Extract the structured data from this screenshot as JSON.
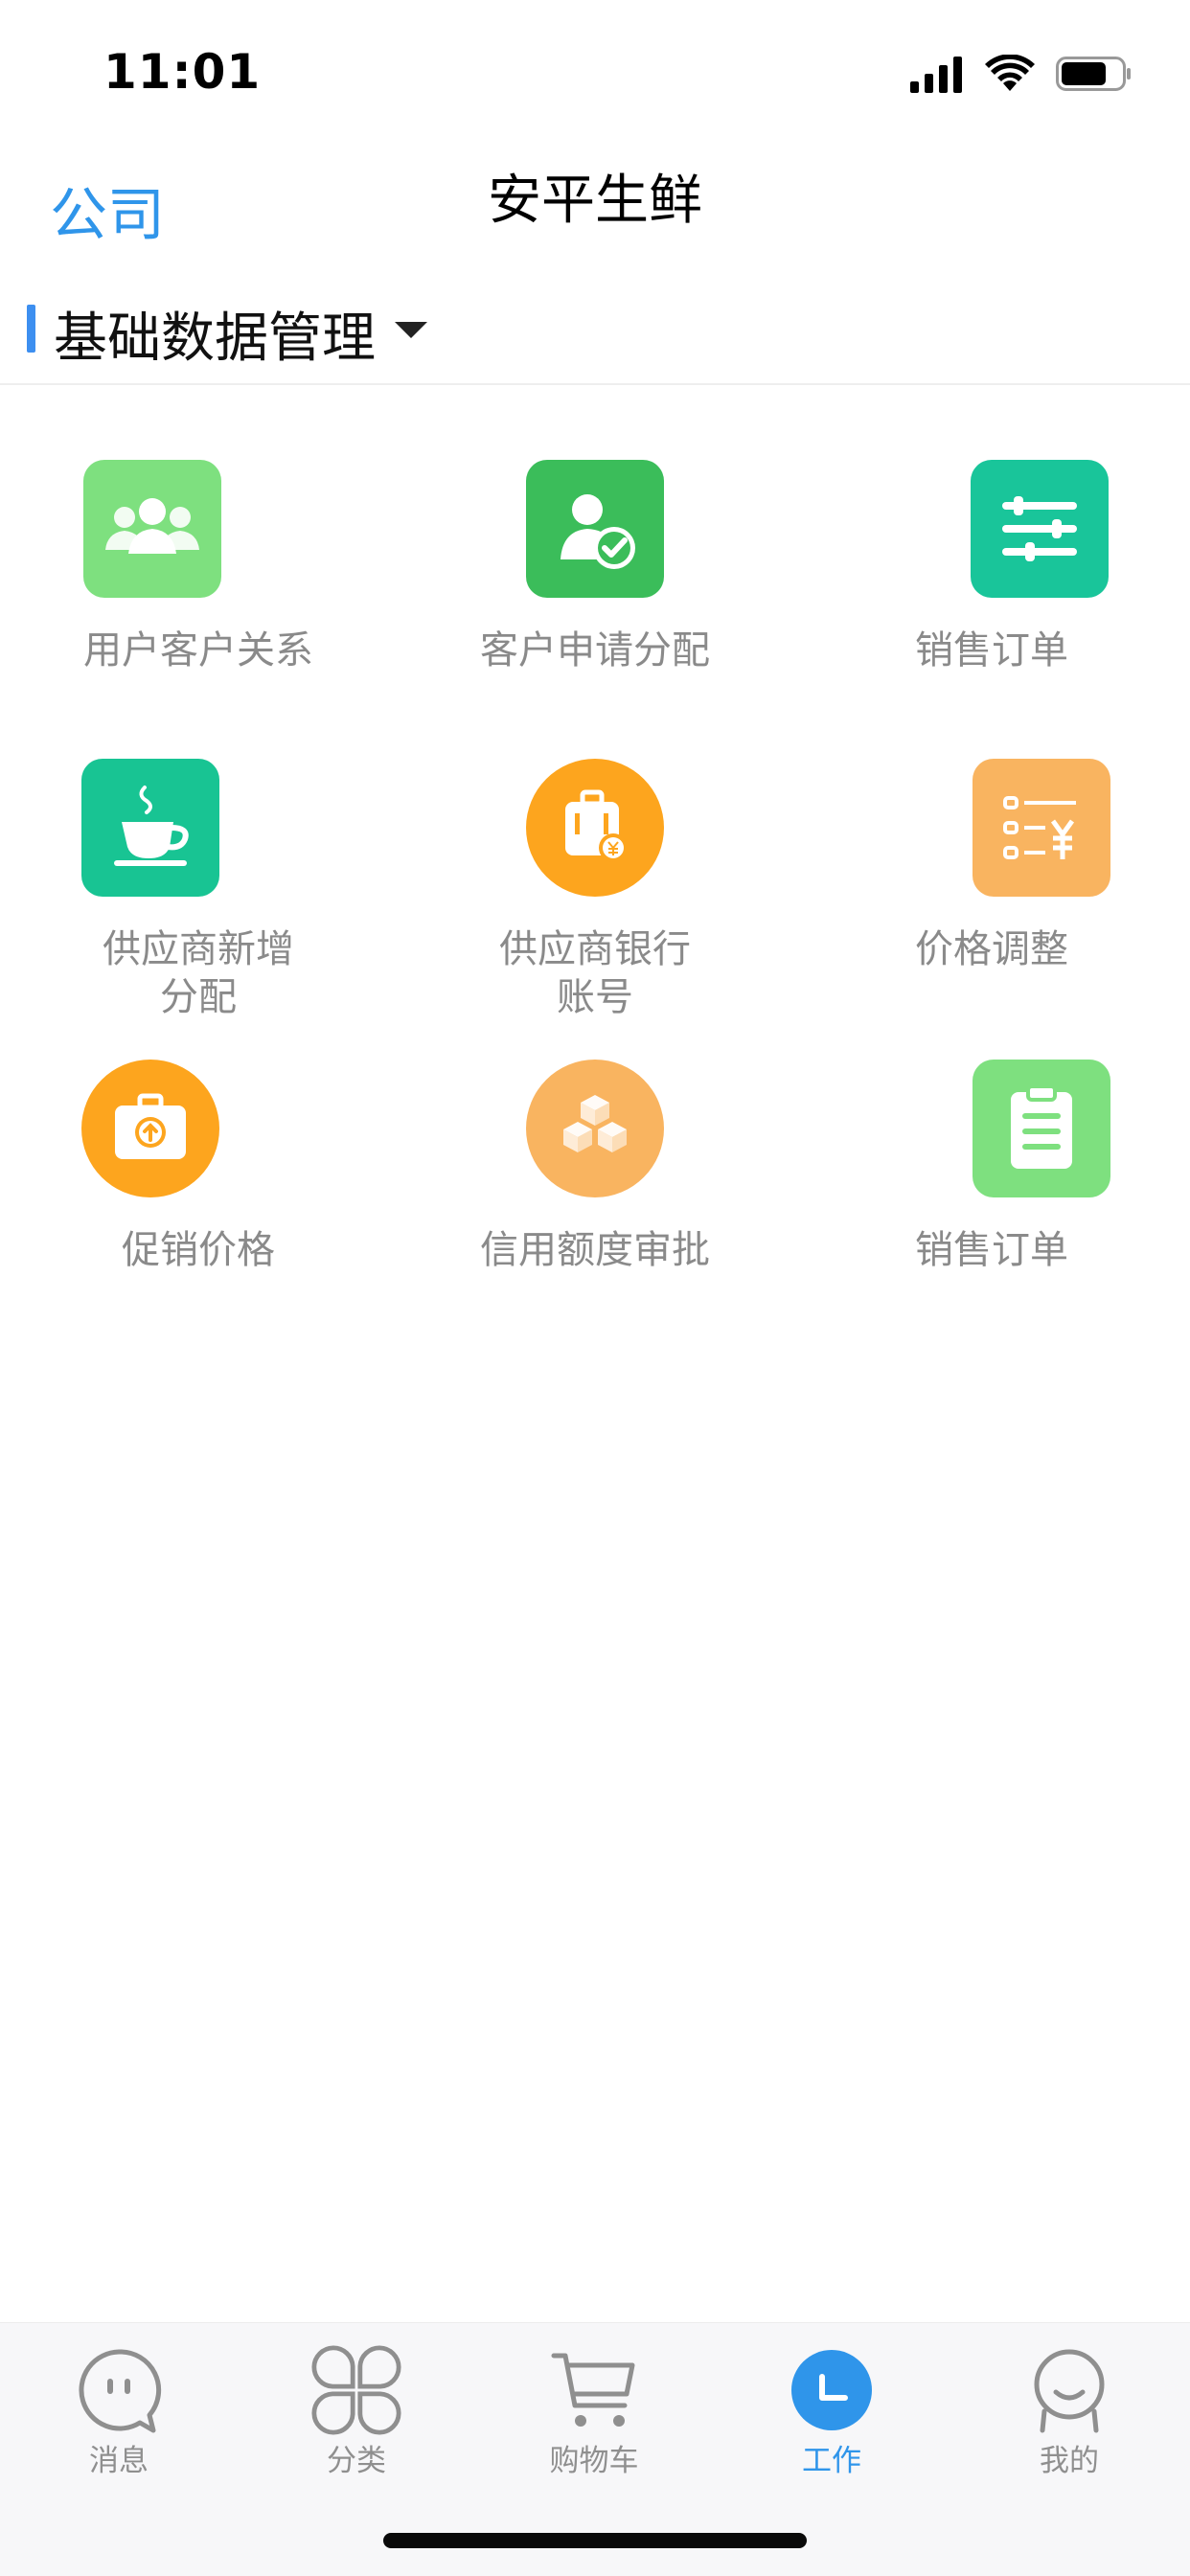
{
  "status_bar": {
    "time": "11:01"
  },
  "nav": {
    "left_label": "公司",
    "title": "安平生鲜"
  },
  "section": {
    "title": "基础数据管理"
  },
  "grid": [
    {
      "label": "用户客户关系",
      "icon": "users-icon",
      "color": "#7ee07f"
    },
    {
      "label": "客户申请分配",
      "icon": "user-check-icon",
      "color": "#3bbd5a"
    },
    {
      "label": "销售订单",
      "icon": "sliders-icon",
      "color": "#19c59a"
    },
    {
      "label": "供应商新增\n分配",
      "icon": "coffee-cup-icon",
      "color": "#18c493"
    },
    {
      "label": "供应商银行\n账号",
      "icon": "suitcase-yen-icon",
      "color": "#fda51e"
    },
    {
      "label": "价格调整",
      "icon": "price-list-icon",
      "color": "#f9b460"
    },
    {
      "label": "促销价格",
      "icon": "upload-briefcase-icon",
      "color": "#fda51e"
    },
    {
      "label": "信用额度审批",
      "icon": "cubes-icon",
      "color": "#f9b460"
    },
    {
      "label": "销售订单",
      "icon": "clipboard-icon",
      "color": "#7ee07f"
    }
  ],
  "tabs": [
    {
      "label": "消息",
      "icon": "message-icon",
      "active": false
    },
    {
      "label": "分类",
      "icon": "category-icon",
      "active": false
    },
    {
      "label": "购物车",
      "icon": "cart-icon",
      "active": false
    },
    {
      "label": "工作",
      "icon": "work-icon",
      "active": true
    },
    {
      "label": "我的",
      "icon": "profile-icon",
      "active": false
    }
  ],
  "colors": {
    "accent": "#2f95ea",
    "inactive_text": "#8a8a8a"
  }
}
